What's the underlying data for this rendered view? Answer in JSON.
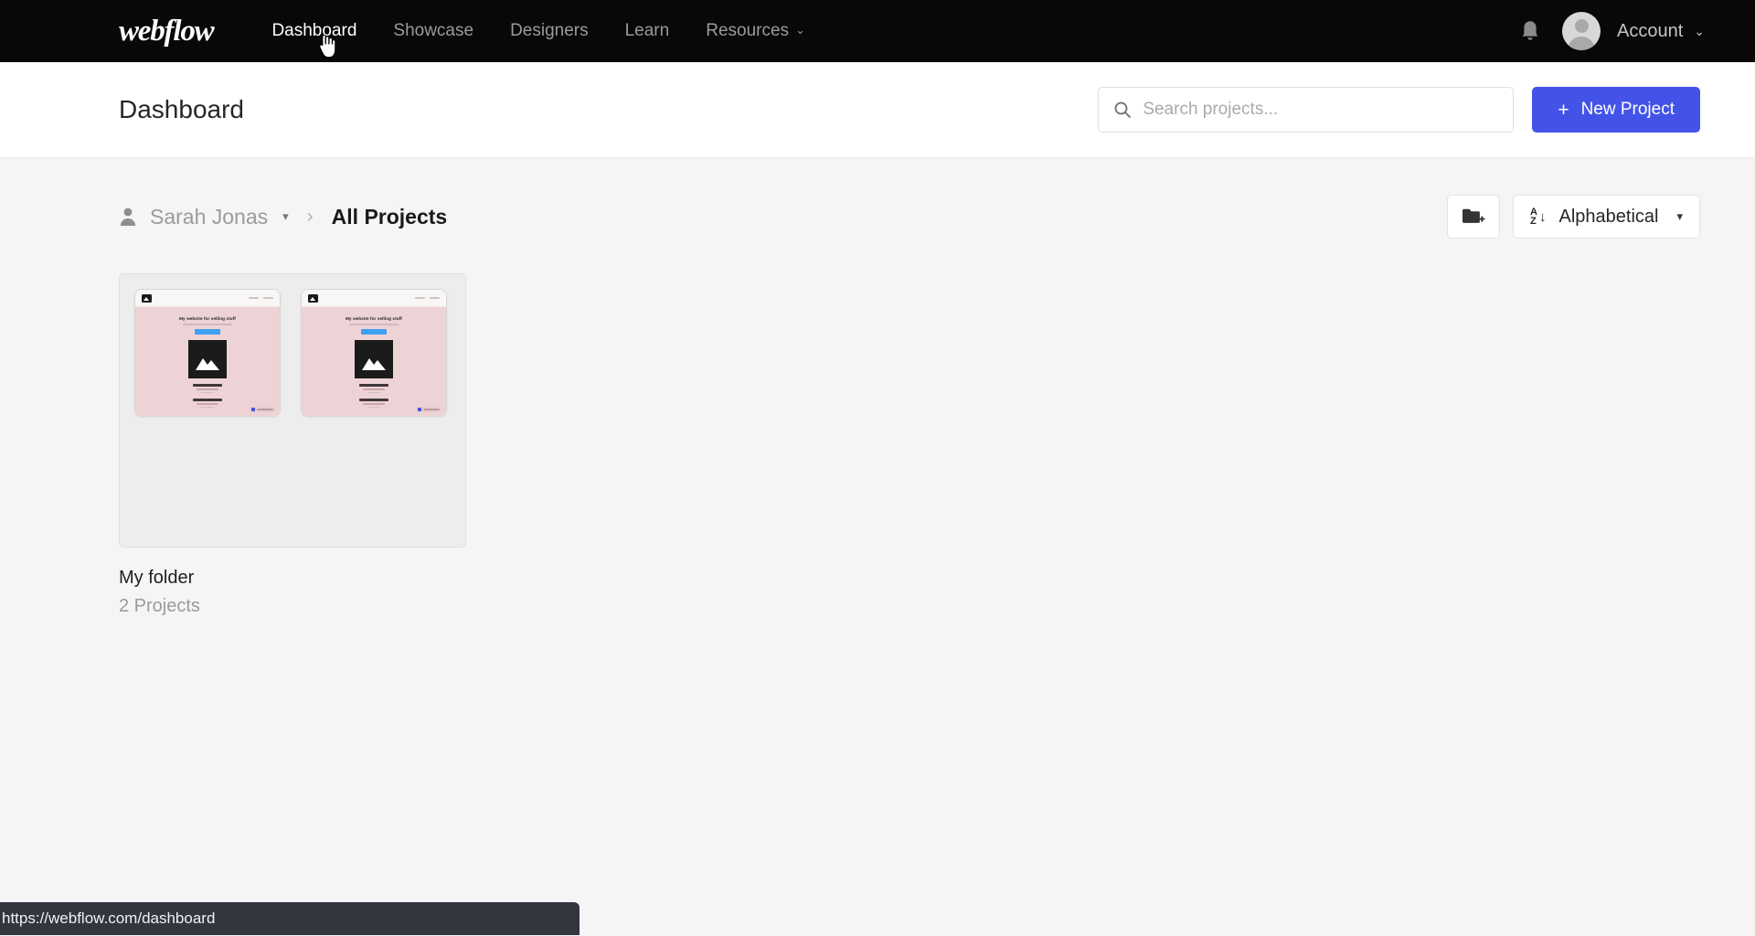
{
  "topnav": {
    "brand": "webflow",
    "links": [
      {
        "label": "Dashboard",
        "active": true,
        "caret": ""
      },
      {
        "label": "Showcase",
        "active": false,
        "caret": ""
      },
      {
        "label": "Designers",
        "active": false,
        "caret": ""
      },
      {
        "label": "Learn",
        "active": false,
        "caret": ""
      },
      {
        "label": "Resources",
        "active": false,
        "caret": "⌄"
      }
    ],
    "notifications_icon": "bell-icon",
    "account_label": "Account",
    "account_caret": "⌄",
    "avatar_icon": "user-avatar-icon",
    "background_color": "#080808"
  },
  "header": {
    "title": "Dashboard",
    "search": {
      "placeholder": "Search projects...",
      "value": "",
      "icon": "search-icon"
    },
    "new_project": {
      "label": "New Project",
      "plus": "+",
      "color": "#4353e8"
    }
  },
  "toolbar": {
    "breadcrumb": {
      "owner": "Sarah Jonas",
      "owner_icon": "person-icon",
      "owner_caret": "▾",
      "separator": "›",
      "current": "All Projects"
    },
    "new_folder_button": {
      "icon": "new-folder-icon",
      "label": ""
    },
    "sort": {
      "icon": "sort-az-icon",
      "letter_top": "A",
      "letter_bottom": "Z",
      "arrow": "↓",
      "label": "Alphabetical",
      "caret": "▾"
    }
  },
  "folders": [
    {
      "name": "My folder",
      "count": "2 Projects",
      "thumbnails": [
        {
          "heading": "My website for selling stuff",
          "cta": "",
          "nav_items": [
            "",
            ""
          ]
        },
        {
          "heading": "My website for selling stuff",
          "cta": "",
          "nav_items": [
            "",
            ""
          ]
        }
      ]
    }
  ],
  "statusbar": {
    "url": "https://webflow.com/dashboard"
  }
}
